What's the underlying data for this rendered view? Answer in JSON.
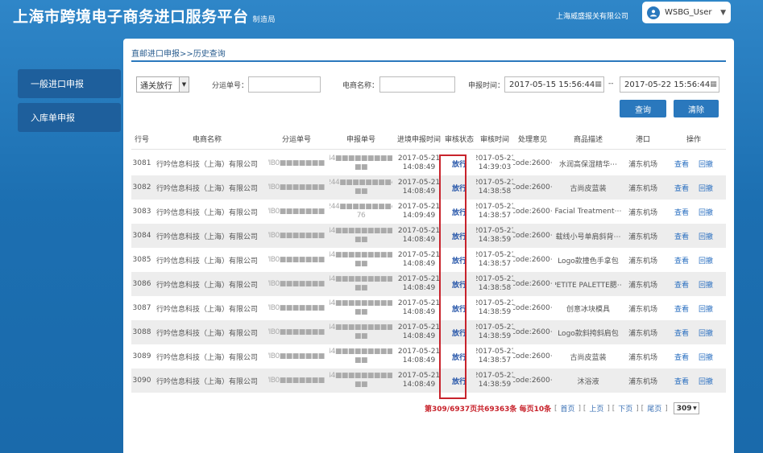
{
  "header": {
    "title": "上海市跨境电子商务进口服务平台",
    "subtitle": "制造局",
    "company": "上海威盛报关有限公司",
    "user": "WSBG_User"
  },
  "sidebar": {
    "items": [
      {
        "label": "一般进口申报"
      },
      {
        "label": "入库单申报"
      }
    ]
  },
  "breadcrumb": "直邮进口申报>>历史查询",
  "filters": {
    "status_select": "通关放行",
    "split_no_label": "分运单号：",
    "split_no_value": "",
    "merchant_label": "电商名称：",
    "merchant_value": "",
    "apply_time_label": "申报时间：",
    "date_from": "2017-05-15 15:56:44",
    "date_sep": "--",
    "date_to": "2017-05-22 15:56:44",
    "query_button": "查询",
    "clear_button": "清除"
  },
  "table": {
    "headers": [
      "行号",
      "电商名称",
      "分运单号",
      "申报单号",
      "进境申报时间",
      "审核状态",
      "审核时间",
      "处理意见",
      "商品描述",
      "港口",
      "操作"
    ],
    "rows": [
      {
        "no": "3081",
        "merchant": "行吟信息科技（上海）有限公司",
        "split": "WIB0■■■■■■■■",
        "decl1": "2244■■■■■■■■■■0",
        "decl2": "■■",
        "time_date": "2017-05-21",
        "time_clock": "14:08:49",
        "status": "放行",
        "audit_date": "2017-05-21",
        "audit_clock": "14:39:03",
        "remark": "[Code:2600⋯",
        "desc": "水润高保湿精华⋯",
        "port": "浦东机场",
        "view": "查看",
        "back": "回撤"
      },
      {
        "no": "3082",
        "merchant": "行吟信息科技（上海）有限公司",
        "split": "WIB0■■■■■■■■",
        "decl1": "2244■■■■■■■■40",
        "decl2": "■■",
        "time_date": "2017-05-21",
        "time_clock": "14:08:49",
        "status": "放行",
        "audit_date": "2017-05-21",
        "audit_clock": "14:38:58",
        "remark": "[Code:2600⋯",
        "desc": "古尚皮蓝装",
        "port": "浦东机场",
        "view": "查看",
        "back": "回撤"
      },
      {
        "no": "3083",
        "merchant": "行吟信息科技（上海）有限公司",
        "split": "WIB0■■■■■■■■",
        "decl1": "2244■■■■■■■■47",
        "decl2": "76",
        "time_date": "2017-05-21",
        "time_clock": "14:09:49",
        "status": "放行",
        "audit_date": "2017-05-21",
        "audit_clock": "14:38:57",
        "remark": "[Code:2600⋯",
        "desc": "Facial Treatment⋯",
        "port": "浦东机场",
        "view": "查看",
        "back": "回撤"
      },
      {
        "no": "3084",
        "merchant": "行吟信息科技（上海）有限公司",
        "split": "WIB0■■■■■■■■",
        "decl1": "2244■■■■■■■■■■0",
        "decl2": "■■",
        "time_date": "2017-05-21",
        "time_clock": "14:08:49",
        "status": "放行",
        "audit_date": "2017-05-21",
        "audit_clock": "14:38:59",
        "remark": "[Code:2600⋯",
        "desc": "载线小号单肩斜背⋯",
        "port": "浦东机场",
        "view": "查看",
        "back": "回撤"
      },
      {
        "no": "3085",
        "merchant": "行吟信息科技（上海）有限公司",
        "split": "WIB0■■■■■■■■",
        "decl1": "2244■■■■■■■■■■0",
        "decl2": "■■",
        "time_date": "2017-05-21",
        "time_clock": "14:08:49",
        "status": "放行",
        "audit_date": "2017-05-21",
        "audit_clock": "14:38:57",
        "remark": "[Code:2600⋯",
        "desc": "Logo款撞色手拿包",
        "port": "浦东机场",
        "view": "查看",
        "back": "回撤"
      },
      {
        "no": "3086",
        "merchant": "行吟信息科技（上海）有限公司",
        "split": "WIB0■■■■■■■■",
        "decl1": "2244■■■■■■■■■■0",
        "decl2": "■■",
        "time_date": "2017-05-21",
        "time_clock": "14:08:49",
        "status": "放行",
        "audit_date": "2017-05-21",
        "audit_clock": "14:38:58",
        "remark": "[Code:2600⋯",
        "desc": "PETITE PALETTE腮⋯",
        "port": "浦东机场",
        "view": "查看",
        "back": "回撤"
      },
      {
        "no": "3087",
        "merchant": "行吟信息科技（上海）有限公司",
        "split": "WIB0■■■■■■■■",
        "decl1": "2244■■■■■■■■■■0",
        "decl2": "■■",
        "time_date": "2017-05-21",
        "time_clock": "14:08:49",
        "status": "放行",
        "audit_date": "2017-05-21",
        "audit_clock": "14:38:59",
        "remark": "[Code:2600⋯",
        "desc": "创意冰块模具",
        "port": "浦东机场",
        "view": "查看",
        "back": "回撤"
      },
      {
        "no": "3088",
        "merchant": "行吟信息科技（上海）有限公司",
        "split": "WIB0■■■■■■■■",
        "decl1": "2244■■■■■■■■■■0",
        "decl2": "■■",
        "time_date": "2017-05-21",
        "time_clock": "14:08:49",
        "status": "放行",
        "audit_date": "2017-05-21",
        "audit_clock": "14:38:59",
        "remark": "[Code:2600⋯",
        "desc": "Logo款斜挎斜肩包",
        "port": "浦东机场",
        "view": "查看",
        "back": "回撤"
      },
      {
        "no": "3089",
        "merchant": "行吟信息科技（上海）有限公司",
        "split": "WIB0■■■■■■■■",
        "decl1": "2244■■■■■■■■■■0",
        "decl2": "■■",
        "time_date": "2017-05-21",
        "time_clock": "14:08:49",
        "status": "放行",
        "audit_date": "2017-05-21",
        "audit_clock": "14:38:57",
        "remark": "[Code:2600⋯",
        "desc": "古尚皮蓝装",
        "port": "浦东机场",
        "view": "查看",
        "back": "回撤"
      },
      {
        "no": "3090",
        "merchant": "行吟信息科技（上海）有限公司",
        "split": "WIB0■■■■■■■■",
        "decl1": "2244■■■■■■■■■■0",
        "decl2": "■■",
        "time_date": "2017-05-21",
        "time_clock": "14:08:49",
        "status": "放行",
        "audit_date": "2017-05-21",
        "audit_clock": "14:38:59",
        "remark": "[Code:2600⋯",
        "desc": "沐浴液",
        "port": "浦东机场",
        "view": "查看",
        "back": "回撤"
      }
    ]
  },
  "pager": {
    "summary": "第309/6937页共69363条 每页10条",
    "first": "首页",
    "prev": "上页",
    "next": "下页",
    "last": "尾页",
    "current": "309"
  },
  "colors": {
    "header_blue": "#2f86c8",
    "accent": "#2a78bd",
    "highlight_red": "#c8232c"
  }
}
